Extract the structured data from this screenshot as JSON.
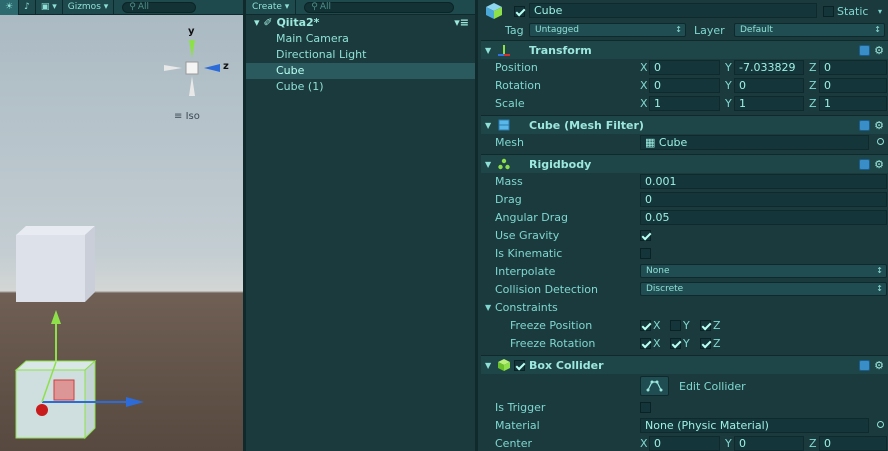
{
  "scene": {
    "toolbar": {
      "gizmos_label": "Gizmos",
      "search_placeholder": "All"
    },
    "gizmo": {
      "y_label": "y",
      "z_label": "z"
    },
    "projection_label": "Iso"
  },
  "hierarchy": {
    "create_label": "Create",
    "search_placeholder": "All",
    "scene_name": "Qiita2*",
    "items": [
      {
        "label": "Main Camera"
      },
      {
        "label": "Directional Light"
      },
      {
        "label": "Cube"
      },
      {
        "label": "Cube (1)"
      }
    ]
  },
  "inspector": {
    "object_name": "Cube",
    "static_label": "Static",
    "tag_label": "Tag",
    "tag_value": "Untagged",
    "layer_label": "Layer",
    "layer_value": "Default",
    "transform": {
      "title": "Transform",
      "position": {
        "label": "Position",
        "x": "0",
        "y": "-7.033829",
        "z": "0"
      },
      "rotation": {
        "label": "Rotation",
        "x": "0",
        "y": "0",
        "z": "0"
      },
      "scale": {
        "label": "Scale",
        "x": "1",
        "y": "1",
        "z": "1"
      },
      "axis_x": "X",
      "axis_y": "Y",
      "axis_z": "Z"
    },
    "mesh_filter": {
      "title": "Cube (Mesh Filter)",
      "mesh_label": "Mesh",
      "mesh_value": "Cube"
    },
    "rigidbody": {
      "title": "Rigidbody",
      "mass_label": "Mass",
      "mass": "0.001",
      "drag_label": "Drag",
      "drag": "0",
      "angular_drag_label": "Angular Drag",
      "angular_drag": "0.05",
      "use_gravity_label": "Use Gravity",
      "is_kinematic_label": "Is Kinematic",
      "interpolate_label": "Interpolate",
      "interpolate": "None",
      "collision_label": "Collision Detection",
      "collision": "Discrete",
      "constraints_label": "Constraints",
      "freeze_position_label": "Freeze Position",
      "freeze_rotation_label": "Freeze Rotation",
      "x": "X",
      "y": "Y",
      "z": "Z"
    },
    "box_collider": {
      "title": "Box Collider",
      "edit_label": "Edit Collider",
      "is_trigger_label": "Is Trigger",
      "material_label": "Material",
      "material": "None (Physic Material)",
      "center_label": "Center",
      "cx": "0",
      "cy": "0",
      "cz": "0",
      "axis_x": "X",
      "axis_y": "Y",
      "axis_z": "Z"
    }
  }
}
